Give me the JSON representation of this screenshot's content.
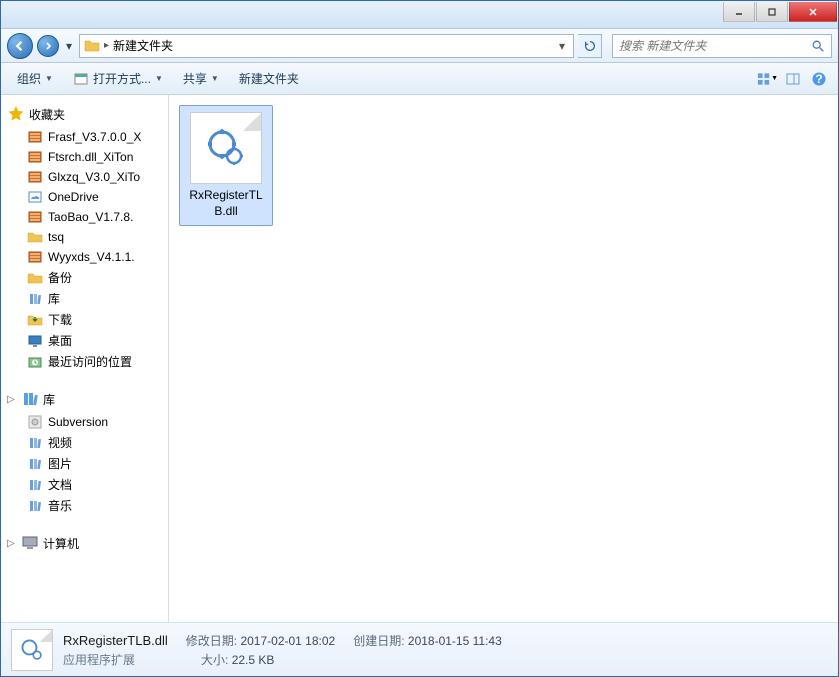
{
  "titlebar": {},
  "nav": {
    "breadcrumb": [
      "新建文件夹"
    ],
    "search_placeholder": "搜索 新建文件夹"
  },
  "toolbar": {
    "organize": "组织",
    "open_with": "打开方式...",
    "share": "共享",
    "new_folder": "新建文件夹"
  },
  "sidebar": {
    "favorites": {
      "label": "收藏夹",
      "items": [
        {
          "label": "Frasf_V3.7.0.0_X",
          "icon": "archive"
        },
        {
          "label": "Ftsrch.dll_XiTon",
          "icon": "archive"
        },
        {
          "label": "Glxzq_V3.0_XiTo",
          "icon": "archive"
        },
        {
          "label": "OneDrive",
          "icon": "onedrive"
        },
        {
          "label": "TaoBao_V1.7.8.",
          "icon": "archive"
        },
        {
          "label": "tsq",
          "icon": "folder"
        },
        {
          "label": "Wyyxds_V4.1.1.",
          "icon": "archive"
        },
        {
          "label": "备份",
          "icon": "folder"
        },
        {
          "label": "库",
          "icon": "library"
        },
        {
          "label": "下载",
          "icon": "download"
        },
        {
          "label": "桌面",
          "icon": "desktop"
        },
        {
          "label": "最近访问的位置",
          "icon": "recent"
        }
      ]
    },
    "libraries": {
      "label": "库",
      "items": [
        {
          "label": "Subversion",
          "icon": "disk"
        },
        {
          "label": "视频",
          "icon": "library"
        },
        {
          "label": "图片",
          "icon": "library"
        },
        {
          "label": "文档",
          "icon": "library"
        },
        {
          "label": "音乐",
          "icon": "library"
        }
      ]
    },
    "computer": {
      "label": "计算机"
    }
  },
  "content": {
    "files": [
      {
        "name": "RxRegisterTLB.dll"
      }
    ]
  },
  "details": {
    "filename": "RxRegisterTLB.dll",
    "filetype": "应用程序扩展",
    "modified_label": "修改日期:",
    "modified": "2017-02-01 18:02",
    "created_label": "创建日期:",
    "created": "2018-01-15 11:43",
    "size_label": "大小:",
    "size": "22.5 KB"
  }
}
